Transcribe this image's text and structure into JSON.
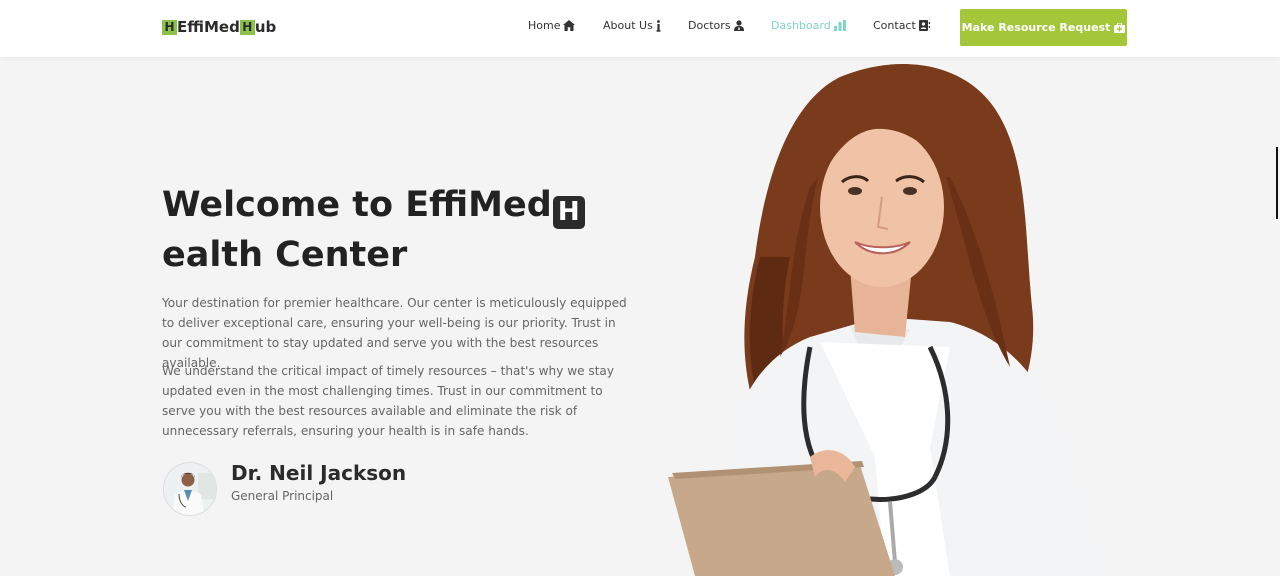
{
  "brand": {
    "h1": "H",
    "part1": "EffiMed",
    "h2": "H",
    "part2": "ub"
  },
  "nav": {
    "items": [
      {
        "label": "Home",
        "icon": "home-icon"
      },
      {
        "label": "About Us",
        "icon": "info-icon"
      },
      {
        "label": "Doctors",
        "icon": "doctor-icon"
      },
      {
        "label": "Dashboard",
        "icon": "bar-chart-icon",
        "active": true
      },
      {
        "label": "Contact",
        "icon": "contact-card-icon"
      }
    ],
    "cta": "Make Resource Request",
    "cta_icon": "medical-kit-icon",
    "active_color": "#7ed6c9",
    "cta_color": "#a4c639"
  },
  "hero": {
    "title_prefix": "Welcome to EffiMed",
    "title_h": "H",
    "title_suffix": "ealth Center",
    "para1": "Your destination for premier healthcare. Our center is meticulously equipped to deliver exceptional care, ensuring your well-being is our priority. Trust in our commitment to stay updated and serve you with the best resources available.",
    "para2": "We understand the critical impact of timely resources – that's why we stay updated even in the most challenging times. Trust in our commitment to serve you with the best resources available and eliminate the risk of unnecessary referrals, ensuring your health is in safe hands.",
    "doctor_name": "Dr. Neil Jackson",
    "doctor_role": "General Principal"
  }
}
